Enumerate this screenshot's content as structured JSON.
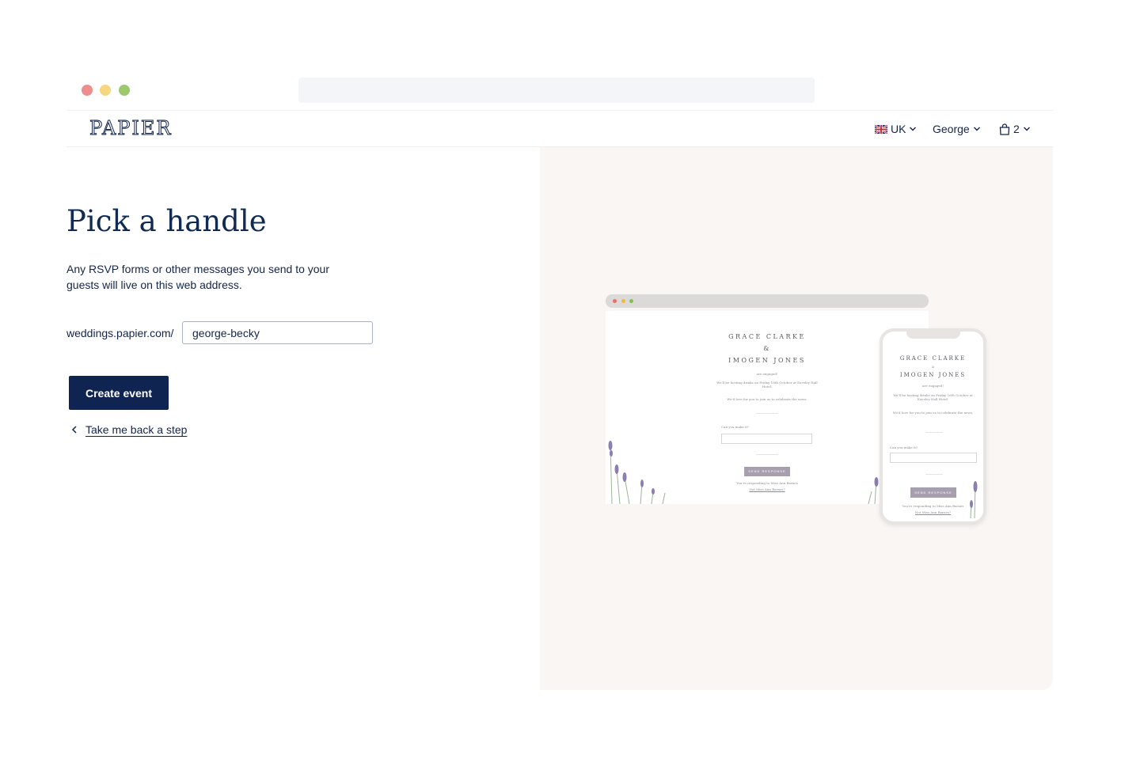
{
  "window": {
    "dots": {
      "red": "#ed8e8c",
      "yellow": "#f6d67e",
      "green": "#9cc86e"
    },
    "url": ""
  },
  "header": {
    "logo": "PAPIER",
    "region": "UK",
    "region_icon": "uk-flag-icon",
    "user": "George",
    "cart_count": "2",
    "cart_icon": "shopping-bag-icon"
  },
  "main": {
    "title": "Pick a handle",
    "description": "Any RSVP forms or other messages you send to your guests will live on this web address.",
    "url_prefix": "weddings.papier.com/",
    "handle_value": "george-becky",
    "create_button": "Create event",
    "back_link": "Take me back a step"
  },
  "preview": {
    "name1": "GRACE CLARKE",
    "ampersand": "&",
    "name2": "IMOGEN JONES",
    "engaged": "are engaged!",
    "details": "We'll be hosting drinks on Friday 16th October at Eaveley Hall Hotel.",
    "invite": "We'd love for you to join us to celebrate the news.",
    "question": "Can you make it?",
    "send_button": "SEND RESPONSE",
    "footer": "You're responding to Miss Ann Barnes",
    "footer_link": "Not Miss Ann Barnes?"
  },
  "colors": {
    "primary": "#0f2450",
    "panel_bg": "#f9f6f3",
    "lavender": "#a89fae"
  }
}
